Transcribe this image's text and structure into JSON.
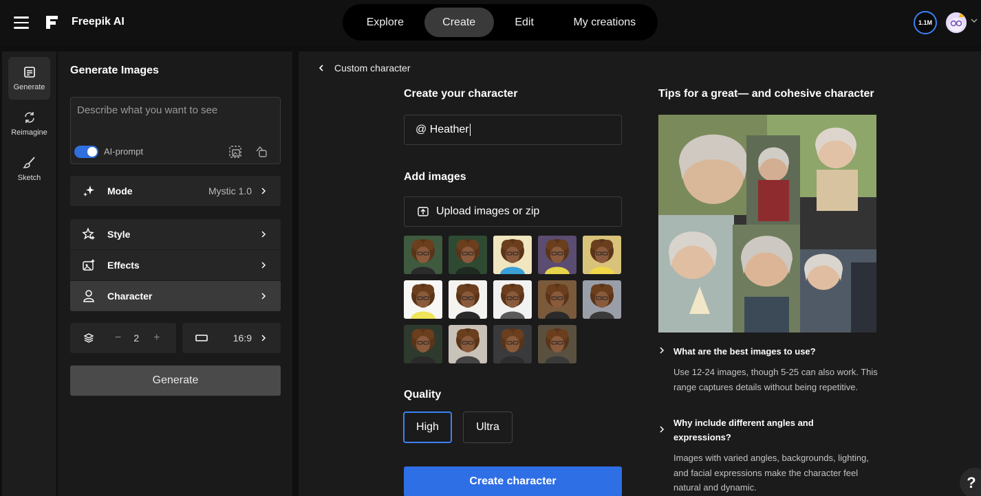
{
  "brand": {
    "name": "Freepik AI"
  },
  "nav": {
    "tabs": [
      "Explore",
      "Create",
      "Edit",
      "My creations"
    ],
    "active_index": 1
  },
  "account": {
    "credits": "1.1M"
  },
  "rail": {
    "items": [
      "Generate",
      "Reimagine",
      "Sketch"
    ],
    "active_index": 0
  },
  "panel": {
    "title": "Generate Images",
    "prompt_placeholder": "Describe what you want to see",
    "ai_prompt_label": "AI-prompt",
    "ai_prompt_enabled": true,
    "mode": {
      "label": "Mode",
      "value": "Mystic 1.0"
    },
    "style_label": "Style",
    "effects_label": "Effects",
    "character_label": "Character",
    "count": {
      "minus": "−",
      "value": "2",
      "plus": "+"
    },
    "aspect": "16:9",
    "generate_label": "Generate"
  },
  "main": {
    "back_label": "Custom character",
    "create_heading": "Create your character",
    "name_value": "@ Heather",
    "add_images_heading": "Add images",
    "upload_label": "Upload images or zip",
    "image_count": 14,
    "quality_heading": "Quality",
    "quality_options": [
      "High",
      "Ultra"
    ],
    "quality_selected": "High",
    "create_label": "Create character",
    "tips_heading": "Tips for a great— and cohesive character",
    "faq": [
      {
        "q": "What are the best images to use?",
        "a": "Use 12-24 images, though 5-25 can also work. This range captures details without being repetitive."
      },
      {
        "q": "Why include different angles and expressions?",
        "a": "Images with varied angles, backgrounds, lighting, and facial expressions make the character feel natural and dynamic."
      }
    ]
  },
  "help": {
    "label": "?"
  },
  "colors": {
    "accent": "#2f6fe6",
    "selected_border": "#3b82f6",
    "background": "#0f0f0f"
  }
}
